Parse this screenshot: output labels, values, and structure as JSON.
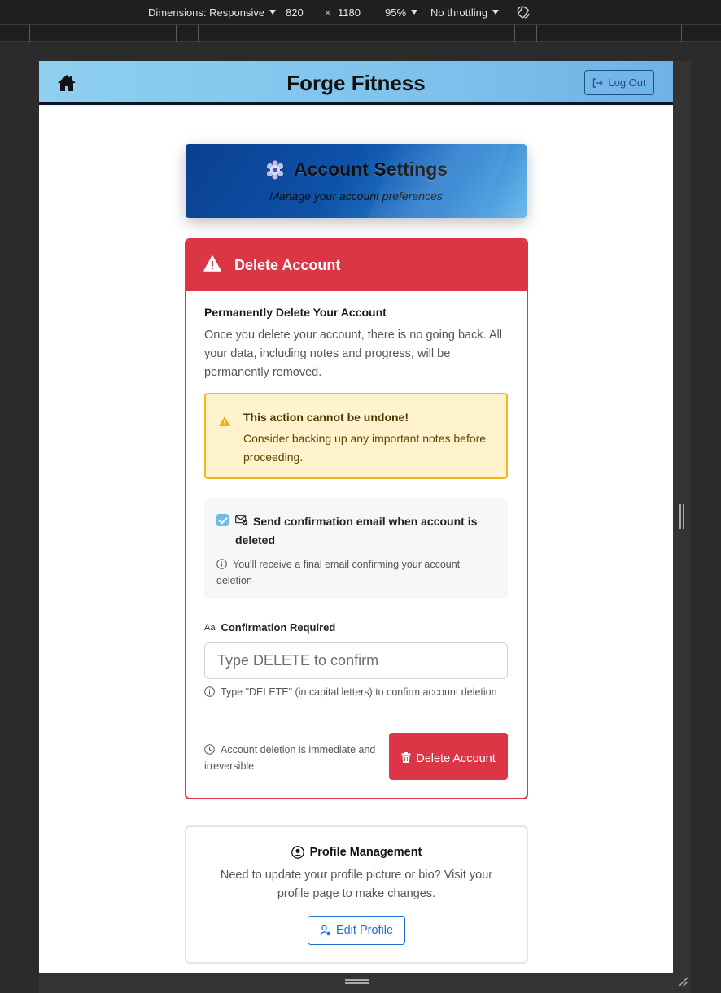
{
  "devtools": {
    "dimensions_label": "Dimensions: Responsive",
    "width": "820",
    "times": "×",
    "height": "1180",
    "zoom": "95%",
    "throttling": "No throttling"
  },
  "header": {
    "title": "Forge Fitness",
    "logout_label": "Log Out"
  },
  "hero": {
    "title": "Account Settings",
    "subtitle": "Manage your account preferences"
  },
  "delete_card": {
    "heading": "Delete Account",
    "section_title": "Permanently Delete Your Account",
    "section_text": "Once you delete your account, there is no going back. All your data, including notes and progress, will be permanently removed.",
    "alert_title": "This action cannot be undone!",
    "alert_text": "Consider backing up any important notes before proceeding.",
    "email_checkbox_label": "Send confirmation email when account is deleted",
    "email_checkbox_checked": true,
    "email_help": "You'll receive a final email confirming your account deletion",
    "confirm_label_icon": "Aa",
    "confirm_label": "Confirmation Required",
    "confirm_input_value": "",
    "confirm_placeholder": "Type DELETE to confirm",
    "confirm_help": "Type \"DELETE\" (in capital letters) to confirm account deletion",
    "irreversible_note": "Account deletion is immediate and irreversible",
    "delete_button_label": "Delete Account"
  },
  "profile_card": {
    "title": "Profile Management",
    "text": "Need to update your profile picture or bio? Visit your profile page to make changes.",
    "button_label": "Edit Profile"
  },
  "icons": {
    "home": "home-icon",
    "logout": "logout-icon",
    "settings": "gear-icon",
    "warning": "warning-triangle-icon",
    "mail": "mail-check-icon",
    "info": "info-circle-icon",
    "clock": "clock-icon",
    "trash": "trash-icon",
    "profile": "user-circle-icon",
    "edit_profile": "user-gear-icon"
  },
  "colors": {
    "danger": "#dc3545",
    "warning_bg": "#fff3cd",
    "warning_border": "#f3b71a",
    "header_gradient_start": "#8fd0f0",
    "hero_dark": "#0b3f8f",
    "primary": "#1a6fd1"
  }
}
